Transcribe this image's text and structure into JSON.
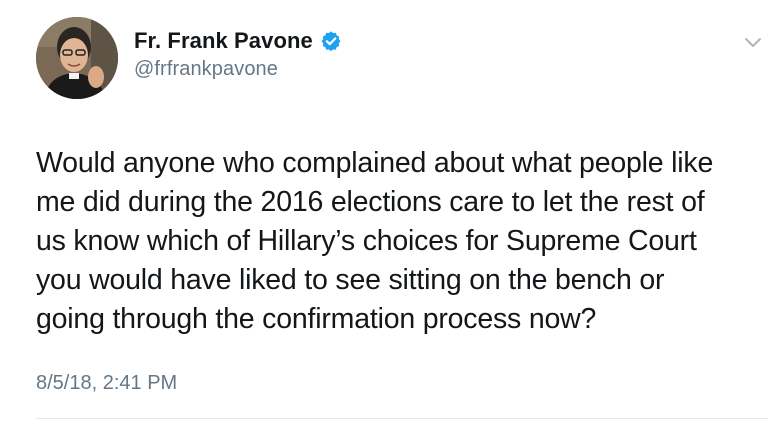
{
  "tweet": {
    "author": {
      "display_name": "Fr. Frank Pavone",
      "handle": "@frfrankpavone",
      "verified": true,
      "avatar_icon": "profile-photo"
    },
    "text": "Would anyone who complained about what people like\nme did during the 2016 elections care to let the rest of\nus know which of Hillary’s choices for Supreme Court\nyou would have liked to see sitting on the bench or\ngoing through the confirmation process now?",
    "timestamp": "8/5/18, 2:41 PM",
    "menu_icon": "chevron-down-icon"
  },
  "colors": {
    "text": "#14171a",
    "secondary": "#657786",
    "verified": "#1da1f2",
    "divider": "#e1e8ed"
  }
}
